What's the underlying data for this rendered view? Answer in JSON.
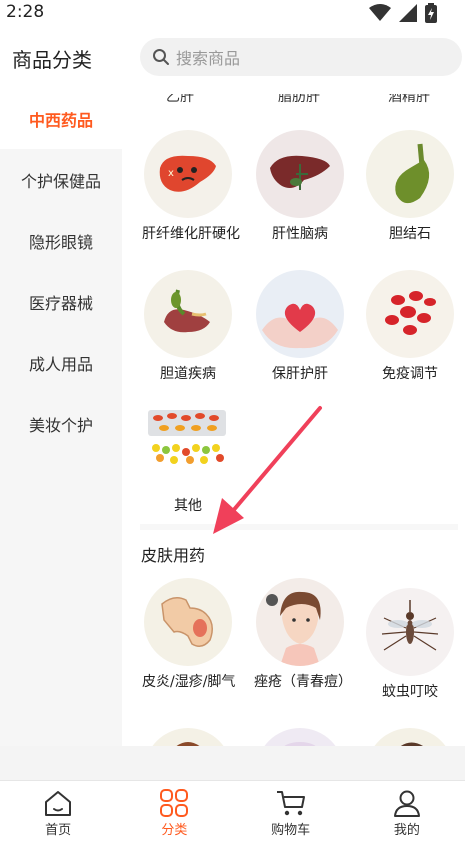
{
  "status_bar": {
    "time": "2:28"
  },
  "header": {
    "title": "商品分类",
    "search_placeholder": "搜索商品"
  },
  "sidebar": {
    "items": [
      {
        "label": "中西药品",
        "active": true
      },
      {
        "label": "个护保健品",
        "active": false
      },
      {
        "label": "隐形眼镜",
        "active": false
      },
      {
        "label": "医疗器械",
        "active": false
      },
      {
        "label": "成人用品",
        "active": false
      },
      {
        "label": "美妆个护",
        "active": false
      }
    ]
  },
  "content": {
    "partial_labels": [
      "乙肝",
      "脂肪肝",
      "酒精肝"
    ],
    "liver_rows": [
      {
        "label": "肝纤维化肝硬化",
        "icon": "liver-icon"
      },
      {
        "label": "肝性脑病",
        "icon": "liver-icon"
      },
      {
        "label": "胆结石",
        "icon": "gallbladder-icon"
      },
      {
        "label": "胆道疾病",
        "icon": "biliary-icon"
      },
      {
        "label": "保肝护肝",
        "icon": "heart-hands-icon"
      },
      {
        "label": "免疫调节",
        "icon": "blood-cells-icon"
      },
      {
        "label": "其他",
        "icon": "pills-icon"
      }
    ],
    "skin_section": {
      "title": "皮肤用药",
      "items": [
        {
          "label": "皮炎/湿疹/脚气",
          "icon": "arm-rash-icon"
        },
        {
          "label": "痤疮（青春痘）",
          "icon": "acne-face-icon"
        },
        {
          "label": "蚊虫叮咬",
          "icon": "mosquito-icon"
        }
      ]
    }
  },
  "tabbar": {
    "tabs": [
      {
        "label": "首页",
        "icon": "home-icon",
        "active": false
      },
      {
        "label": "分类",
        "icon": "category-icon",
        "active": true
      },
      {
        "label": "购物车",
        "icon": "cart-icon",
        "active": false
      },
      {
        "label": "我的",
        "icon": "user-icon",
        "active": false
      }
    ]
  },
  "colors": {
    "accent": "#ff5a1f",
    "annotation_arrow": "#f0405a"
  }
}
